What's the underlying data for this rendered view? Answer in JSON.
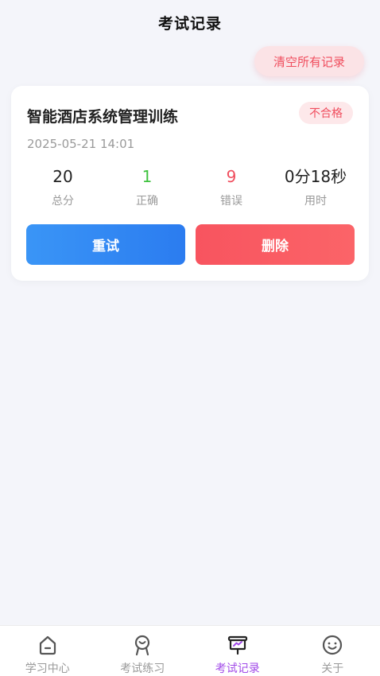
{
  "header": {
    "title": "考试记录"
  },
  "actions": {
    "clear_all_label": "清空所有记录"
  },
  "records": [
    {
      "title": "智能酒店系统管理训练",
      "status": "不合格",
      "time": "2025-05-21 14:01",
      "stats": [
        {
          "value": "20",
          "label": "总分"
        },
        {
          "value": "1",
          "label": "正确"
        },
        {
          "value": "9",
          "label": "错误"
        },
        {
          "value": "0分18秒",
          "label": "用时"
        }
      ],
      "retry_label": "重试",
      "delete_label": "删除"
    }
  ],
  "tabs": [
    {
      "label": "学习中心",
      "icon": "home-icon"
    },
    {
      "label": "考试练习",
      "icon": "practice-icon"
    },
    {
      "label": "考试记录",
      "icon": "record-icon",
      "active": true
    },
    {
      "label": "关于",
      "icon": "smile-icon"
    }
  ],
  "colors": {
    "accent": "#a14ae8",
    "danger": "#f04e5e",
    "primary": "#2b7cf0",
    "success": "#3ec23e"
  }
}
